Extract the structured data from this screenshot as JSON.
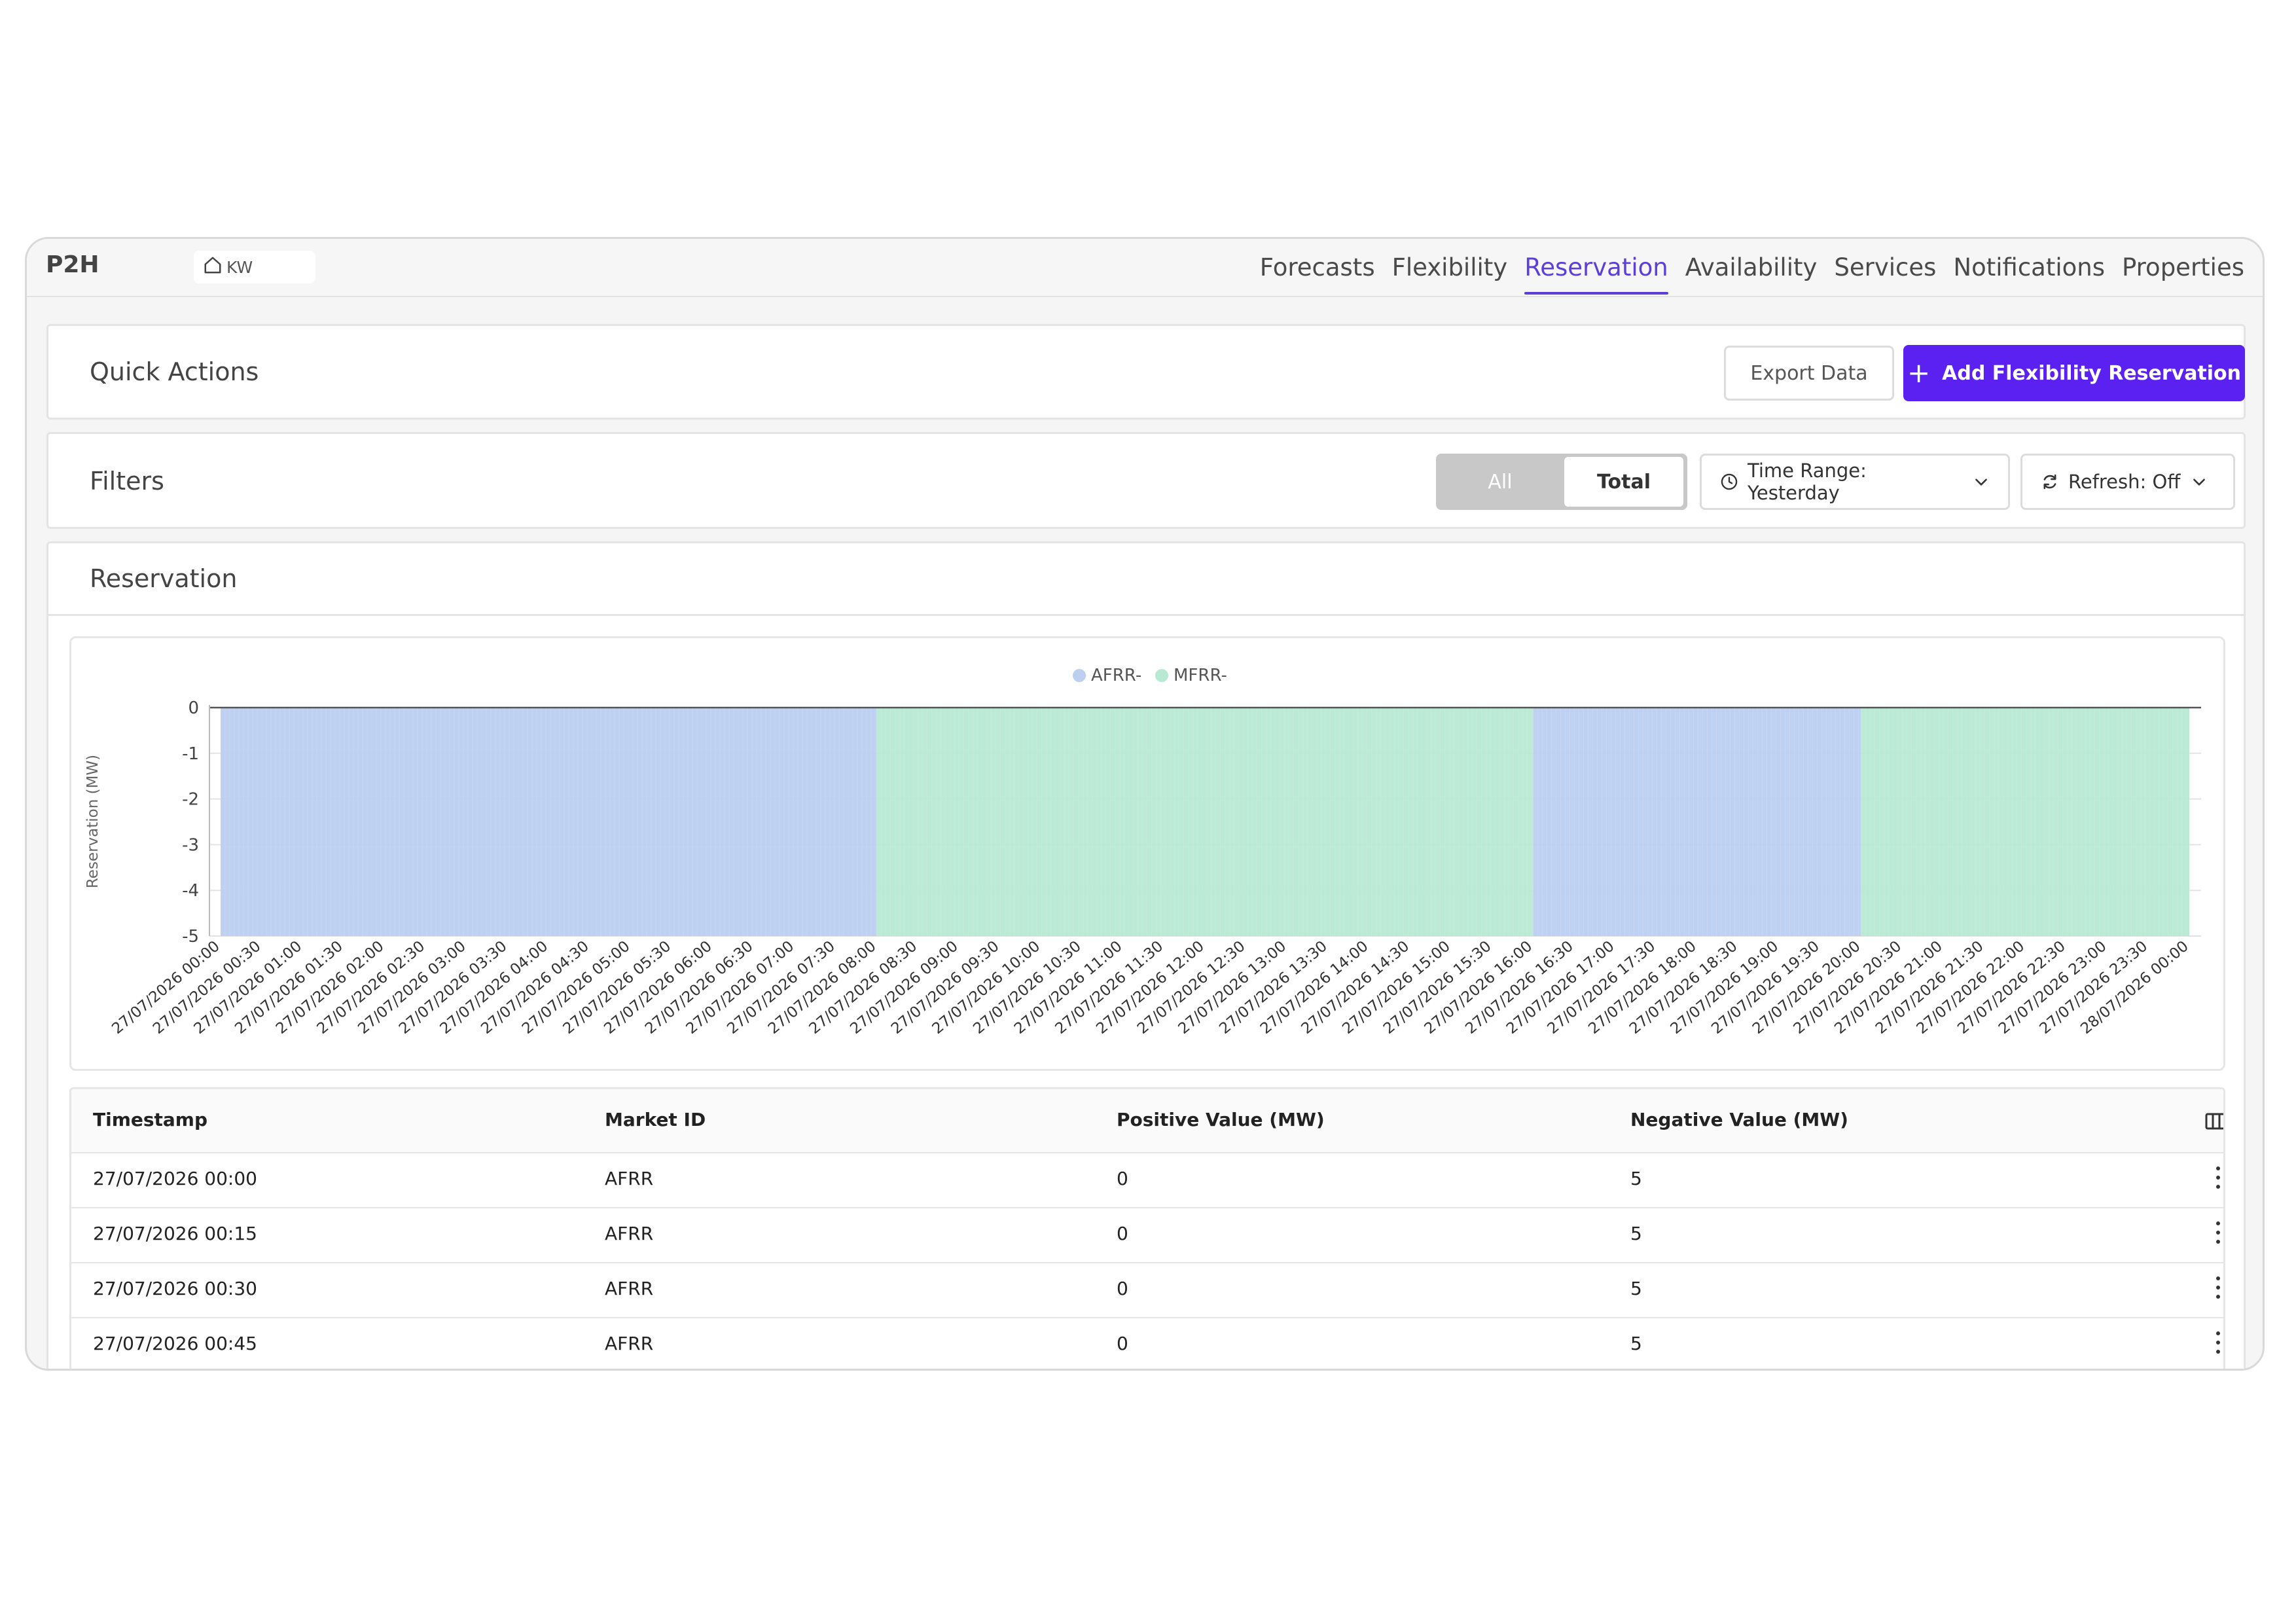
{
  "app": {
    "title": "P2H",
    "unit": "KW"
  },
  "nav": {
    "tabs": [
      {
        "label": "Forecasts",
        "active": false
      },
      {
        "label": "Flexibility",
        "active": false
      },
      {
        "label": "Reservation",
        "active": true
      },
      {
        "label": "Availability",
        "active": false
      },
      {
        "label": "Services",
        "active": false
      },
      {
        "label": "Notifications",
        "active": false
      },
      {
        "label": "Properties",
        "active": false
      }
    ]
  },
  "quick_actions": {
    "title": "Quick Actions",
    "export_label": "Export Data",
    "add_label": "Add Flexibility Reservation"
  },
  "filters": {
    "title": "Filters",
    "seg_all": "All",
    "seg_total": "Total",
    "selected_segment": "Total",
    "time_range": "Time Range: Yesterday",
    "refresh": "Refresh: Off"
  },
  "reservation": {
    "title": "Reservation"
  },
  "colors": {
    "accent": "#5b21f0",
    "tab_active": "#5b3fd6",
    "afrr": "#bccff1",
    "mfrr": "#b7e9d3"
  },
  "chart_data": {
    "type": "area",
    "ylabel": "Reservation (MW)",
    "xlabel": "",
    "ylim": [
      -5,
      0
    ],
    "yticks": [
      0,
      -1,
      -2,
      -3,
      -4,
      -5
    ],
    "legend": [
      "AFRR-",
      "MFRR-"
    ],
    "legend_position": "top-center",
    "x_start": "27/07/2026 00:00",
    "x_end": "28/07/2026 00:00",
    "x_ticks": [
      "27/07/2026 00:00",
      "27/07/2026 00:30",
      "27/07/2026 01:00",
      "27/07/2026 01:30",
      "27/07/2026 02:00",
      "27/07/2026 02:30",
      "27/07/2026 03:00",
      "27/07/2026 03:30",
      "27/07/2026 04:00",
      "27/07/2026 04:30",
      "27/07/2026 05:00",
      "27/07/2026 05:30",
      "27/07/2026 06:00",
      "27/07/2026 06:30",
      "27/07/2026 07:00",
      "27/07/2026 07:30",
      "27/07/2026 08:00",
      "27/07/2026 08:30",
      "27/07/2026 09:00",
      "27/07/2026 09:30",
      "27/07/2026 10:00",
      "27/07/2026 10:30",
      "27/07/2026 11:00",
      "27/07/2026 11:30",
      "27/07/2026 12:00",
      "27/07/2026 12:30",
      "27/07/2026 13:00",
      "27/07/2026 13:30",
      "27/07/2026 14:00",
      "27/07/2026 14:30",
      "27/07/2026 15:00",
      "27/07/2026 15:30",
      "27/07/2026 16:00",
      "27/07/2026 16:30",
      "27/07/2026 17:00",
      "27/07/2026 17:30",
      "27/07/2026 18:00",
      "27/07/2026 18:30",
      "27/07/2026 19:00",
      "27/07/2026 19:30",
      "27/07/2026 20:00",
      "27/07/2026 20:30",
      "27/07/2026 21:00",
      "27/07/2026 21:30",
      "27/07/2026 22:00",
      "27/07/2026 22:30",
      "27/07/2026 23:00",
      "27/07/2026 23:30",
      "28/07/2026 00:00"
    ],
    "series": [
      {
        "name": "AFRR-",
        "color": "#bccff1",
        "segments": [
          {
            "from": "27/07/2026 00:00",
            "to": "27/07/2026 08:00",
            "value": -5
          },
          {
            "from": "27/07/2026 16:00",
            "to": "27/07/2026 20:00",
            "value": -5
          }
        ]
      },
      {
        "name": "MFRR-",
        "color": "#b7e9d3",
        "segments": [
          {
            "from": "27/07/2026 08:00",
            "to": "27/07/2026 16:00",
            "value": -5
          },
          {
            "from": "27/07/2026 20:00",
            "to": "28/07/2026 00:00",
            "value": -5
          }
        ]
      }
    ],
    "grid": true
  },
  "table": {
    "headers": [
      "Timestamp",
      "Market ID",
      "Positive Value (MW)",
      "Negative Value (MW)"
    ],
    "rows": [
      [
        "27/07/2026 00:00",
        "AFRR",
        "0",
        "5"
      ],
      [
        "27/07/2026 00:15",
        "AFRR",
        "0",
        "5"
      ],
      [
        "27/07/2026 00:30",
        "AFRR",
        "0",
        "5"
      ],
      [
        "27/07/2026 00:45",
        "AFRR",
        "0",
        "5"
      ]
    ]
  }
}
